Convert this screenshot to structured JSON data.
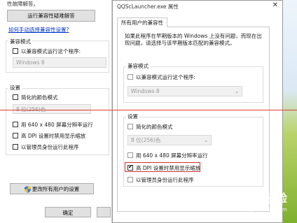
{
  "back_window": {
    "header_text": "性故障解答。",
    "troubleshoot_button": "运行兼容性疑难解答",
    "manual_link": "如何手动选择兼容性设置?",
    "compat_group": "兼容模式",
    "compat_check": "以兼容模式运行这个程序:",
    "compat_os": "Windows 8",
    "settings_group": "设置",
    "reduced_color": "简化的颜色模式",
    "color_value": "8 位(256)色",
    "res_640": "用 640 x 480 屏幕分辨率运行",
    "dpi_scaling": "高 DPI 设置时禁用显示缩放",
    "run_admin": "以管理员身份运行此程序",
    "all_users_button": "更改所有用户的设置",
    "ok_button": "确定"
  },
  "dialog": {
    "title": "QQScLauncher.exe 属性",
    "tab_label": "所有用户的兼容性",
    "description": "如果此程序在早期版本的 Windows 上没有问题，而现在出现问题，请选择与该早期版本匹配的兼容模式。",
    "compat_group": "兼容模式",
    "compat_check": "以兼容模式运行这个程序:",
    "compat_os": "Windows 8",
    "settings_group": "设置",
    "reduced_color": "简化的颜色模式",
    "color_value": "8 位(256)色",
    "res_640": "用 640 x 480 屏幕分辨率运行",
    "dpi_scaling": "高 DPI 设置时禁用显示缩放",
    "run_admin": "以管理员身份运行此程序"
  },
  "watermark": {
    "text": "Baidu经验",
    "sub": "jingyan.baidu.com"
  },
  "colors": {
    "annotation": "#d32f2f",
    "link": "#0033cc"
  }
}
